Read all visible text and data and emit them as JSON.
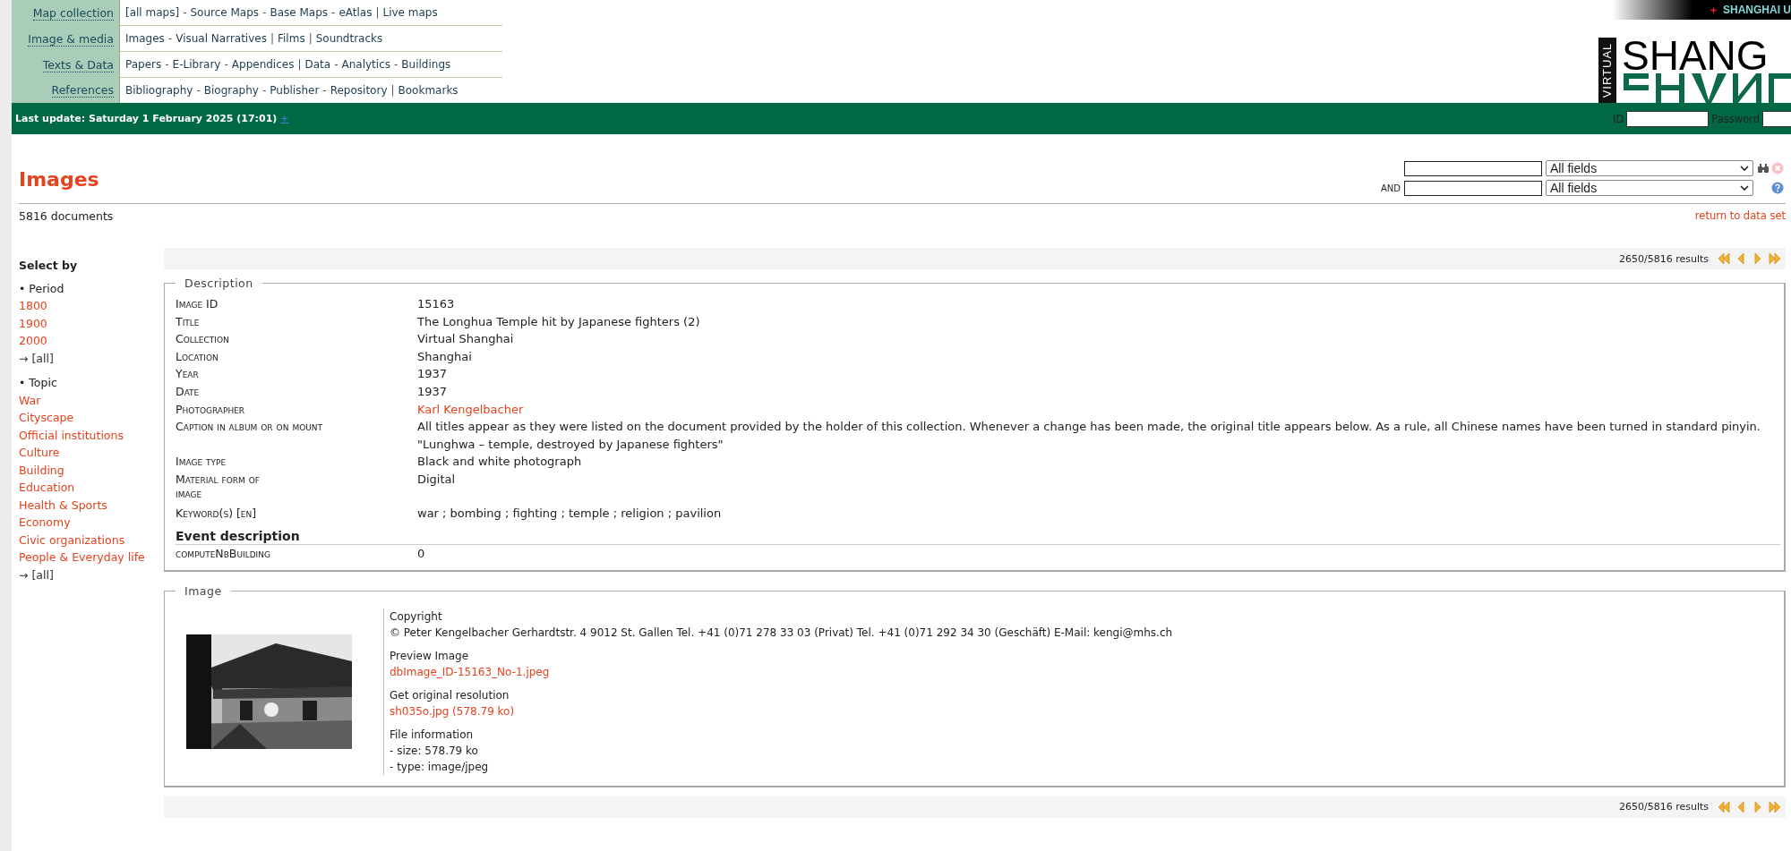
{
  "nav": [
    {
      "label": "Map collection",
      "links": [
        {
          "text": "[all maps]",
          "sep": "-"
        },
        {
          "text": "Source Maps",
          "sep": "-"
        },
        {
          "text": "Base Maps",
          "sep": "-"
        },
        {
          "text": "eAtlas",
          "sep": "|"
        },
        {
          "text": "Live maps"
        }
      ]
    },
    {
      "label": "Image & media",
      "links": [
        {
          "text": "Images",
          "sep": "-"
        },
        {
          "text": "Visual Narratives",
          "sep": "|"
        },
        {
          "text": "Films",
          "sep": "|"
        },
        {
          "text": "Soundtracks"
        }
      ]
    },
    {
      "label": "Texts & Data",
      "links": [
        {
          "text": "Papers",
          "sep": "-"
        },
        {
          "text": "E-Library",
          "sep": "-"
        },
        {
          "text": "Appendices",
          "sep": "|"
        },
        {
          "text": "Data",
          "sep": "-"
        },
        {
          "text": "Analytics",
          "sep": "-"
        },
        {
          "text": "Buildings"
        }
      ]
    },
    {
      "label": "References",
      "links": [
        {
          "text": "Bibliography",
          "sep": "-"
        },
        {
          "text": "Biography",
          "sep": "-"
        },
        {
          "text": "Publisher",
          "sep": "-"
        },
        {
          "text": "Repository",
          "sep": "|"
        },
        {
          "text": "Bookmarks"
        }
      ]
    }
  ],
  "top_banner": {
    "text": "SHANGHAI U"
  },
  "logo": {
    "side": "VIRTUAL",
    "main": "SHANG"
  },
  "status_bar": {
    "last_update": "Last update: Saturday 1 February 2025 (17:01)",
    "plus_link": "+",
    "id_label": "ID",
    "password_label": "Password"
  },
  "page_title": "Images",
  "count": "5816 documents",
  "search": {
    "rows": [
      {
        "prefix": null,
        "field": "All fields"
      },
      {
        "prefix": "AND",
        "field": "All fields"
      }
    ]
  },
  "return_link": "return to data set",
  "sidebar": {
    "title": "Select by",
    "groups": [
      {
        "bullet": "•",
        "label": "Period",
        "items": [
          "1800",
          "1900",
          "2000"
        ],
        "all": "→ [all]"
      },
      {
        "bullet": "•",
        "label": "Topic",
        "items": [
          "War",
          "Cityscape",
          "Official institutions",
          "Culture",
          "Building",
          "Education",
          "Health & Sports",
          "Economy",
          "Civic organizations",
          "People & Everyday life"
        ],
        "all": "→ [all]"
      }
    ]
  },
  "pager": {
    "results": "2650/5816 results"
  },
  "description": {
    "legend": "Description",
    "rows": [
      {
        "label": "Image ID",
        "value": "15163"
      },
      {
        "label": "Title",
        "value": "The Longhua Temple hit by Japanese fighters (2)"
      },
      {
        "label": "Collection",
        "value": "Virtual Shanghai"
      },
      {
        "label": "Location",
        "value": "Shanghai"
      },
      {
        "label": "Year",
        "value": "1937"
      },
      {
        "label": "Date",
        "value": "1937"
      },
      {
        "label": "Photographer",
        "value": "Karl Kengelbacher",
        "link": true
      },
      {
        "label": "Caption in album or on mount",
        "values": [
          "All titles appear as they were listed on the document provided by the holder of this collection. Whenever a change has been made, the original title appears below. As a rule, all Chinese names have been turned in standard pinyin.",
          "\"Lunghwa – temple, destroyed by Japanese fighters\""
        ]
      },
      {
        "label": "Image type",
        "value": "Black and white photograph"
      },
      {
        "label": "Material form of image",
        "value": "Digital",
        "wrap": true
      },
      {
        "label": "Keyword(s) [en]",
        "value": "war ; bombing ; fighting ; temple ; religion ; pavilion",
        "gap": true
      }
    ],
    "event_title": "Event description",
    "event_rows": [
      {
        "label": "computeNbBuilding",
        "value": "0"
      }
    ]
  },
  "image": {
    "legend": "Image",
    "blocks": [
      {
        "heading": "Copyright",
        "lines": [
          {
            "text": "© Peter Kengelbacher Gerhardtstr. 4 9012 St. Gallen Tel. +41 (0)71 278 33 03 (Privat) Tel. +41 (0)71 292 34 30 (Geschäft) E-Mail: kengi@mhs.ch"
          }
        ]
      },
      {
        "heading": "Preview Image",
        "lines": [
          {
            "text": "dbImage_ID-15163_No-1.jpeg",
            "link": true
          }
        ]
      },
      {
        "heading": "Get original resolution",
        "lines": [
          {
            "text": "sh035o.jpg (578.79 ko)",
            "link": true
          }
        ]
      },
      {
        "heading": "File information",
        "lines": [
          {
            "text": "- size: 578.79 ko"
          },
          {
            "text": "- type: image/jpeg"
          }
        ]
      }
    ]
  },
  "bottom_pager": {
    "results": "2650/5816 results"
  }
}
